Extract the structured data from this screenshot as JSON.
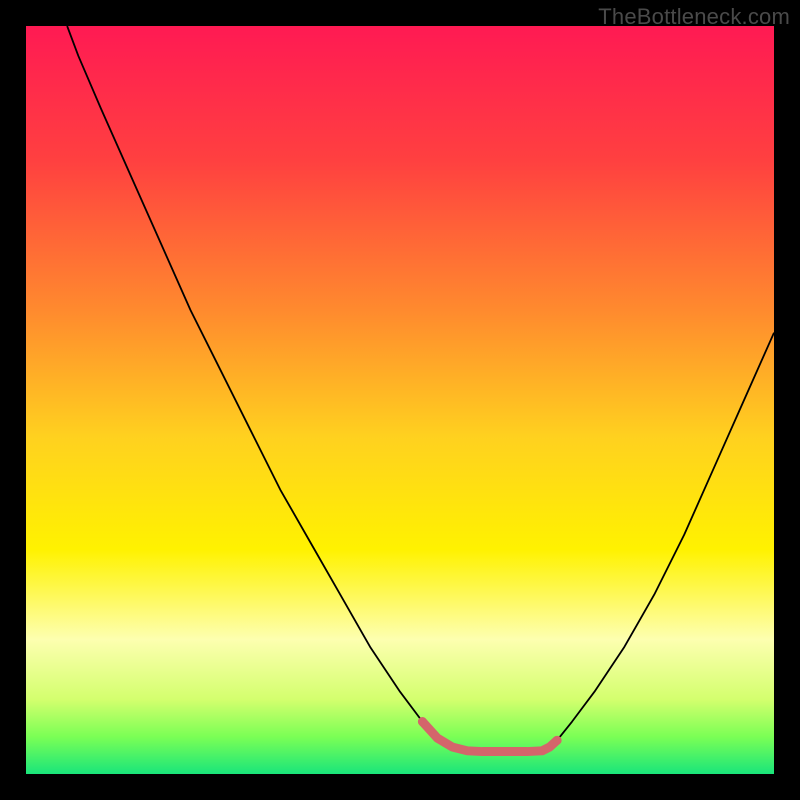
{
  "watermark": "TheBottleneck.com",
  "chart_data": {
    "type": "line",
    "title": "",
    "xlabel": "",
    "ylabel": "",
    "xlim": [
      0,
      100
    ],
    "ylim": [
      0,
      100
    ],
    "background_gradient": {
      "stops": [
        {
          "offset": 0,
          "color": "#ff1a53"
        },
        {
          "offset": 18,
          "color": "#ff4040"
        },
        {
          "offset": 38,
          "color": "#ff8a2e"
        },
        {
          "offset": 55,
          "color": "#ffd11f"
        },
        {
          "offset": 70,
          "color": "#fff200"
        },
        {
          "offset": 82,
          "color": "#fdffb0"
        },
        {
          "offset": 90,
          "color": "#d4ff6e"
        },
        {
          "offset": 95,
          "color": "#7bff55"
        },
        {
          "offset": 100,
          "color": "#19e57a"
        }
      ]
    },
    "series": [
      {
        "name": "left-branch",
        "color": "#000000",
        "width": 1.8,
        "x": [
          5.5,
          7,
          10,
          14,
          18,
          22,
          26,
          30,
          34,
          38,
          42,
          46,
          50,
          53,
          55.5
        ],
        "y": [
          100,
          96,
          89,
          80,
          71,
          62,
          54,
          46,
          38,
          31,
          24,
          17,
          11,
          7,
          4.5
        ]
      },
      {
        "name": "right-branch",
        "color": "#000000",
        "width": 1.8,
        "x": [
          71,
          73,
          76,
          80,
          84,
          88,
          92,
          96,
          100
        ],
        "y": [
          4.5,
          7,
          11,
          17,
          24,
          32,
          41,
          50,
          59
        ]
      },
      {
        "name": "highlighted-bottom",
        "color": "#d4656b",
        "width": 9,
        "linecap": "round",
        "x": [
          53,
          55,
          57,
          59,
          61,
          63,
          65,
          67,
          69,
          70,
          71
        ],
        "y": [
          7,
          4.8,
          3.6,
          3.1,
          3.0,
          3.0,
          3.0,
          3.0,
          3.1,
          3.6,
          4.5
        ]
      }
    ]
  }
}
